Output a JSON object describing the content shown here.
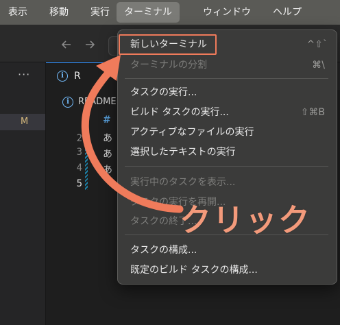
{
  "menubar": {
    "items": [
      {
        "label": "表示"
      },
      {
        "label": "移動"
      },
      {
        "label": "実行"
      },
      {
        "label": "ターミナル",
        "active": true
      },
      {
        "label": "ウィンドウ"
      },
      {
        "label": "ヘルプ"
      }
    ]
  },
  "titlebar": {
    "back_icon": "arrow-left-icon",
    "forward_icon": "arrow-right-icon"
  },
  "sidebar": {
    "more_label": "···",
    "status_badge": "M"
  },
  "editor": {
    "tab_label": "R",
    "breadcrumb": "README",
    "line_numbers": [
      "2",
      "3",
      "4",
      "5"
    ],
    "lines": [
      "#",
      "あ",
      "あ",
      "あ",
      ""
    ]
  },
  "terminal_menu": {
    "items": [
      {
        "label": "新しいターミナル",
        "shortcut": "^⇧`",
        "disabled": false,
        "highlighted": true
      },
      {
        "label": "ターミナルの分割",
        "shortcut": "⌘\\",
        "disabled": true
      },
      {
        "label": "タスクの実行...",
        "shortcut": "",
        "disabled": false
      },
      {
        "label": "ビルド タスクの実行...",
        "shortcut": "⇧⌘B",
        "disabled": false
      },
      {
        "label": "アクティブなファイルの実行",
        "shortcut": "",
        "disabled": false
      },
      {
        "label": "選択したテキストの実行",
        "shortcut": "",
        "disabled": false
      },
      {
        "label": "実行中のタスクを表示...",
        "shortcut": "",
        "disabled": true
      },
      {
        "label": "タスクの実行を再開...",
        "shortcut": "",
        "disabled": true
      },
      {
        "label": "タスクの終了...",
        "shortcut": "",
        "disabled": true
      },
      {
        "label": "タスクの構成...",
        "shortcut": "",
        "disabled": false
      },
      {
        "label": "既定のビルド タスクの構成...",
        "shortcut": "",
        "disabled": false
      }
    ]
  },
  "annotation": {
    "label": "クリック",
    "color": "#f07b5b"
  },
  "colors": {
    "menubar_bg": "#5a5a56",
    "menu_bg": "#3b3b3a",
    "editor_bg": "#1e1e1e",
    "accent": "#f07b5b"
  }
}
